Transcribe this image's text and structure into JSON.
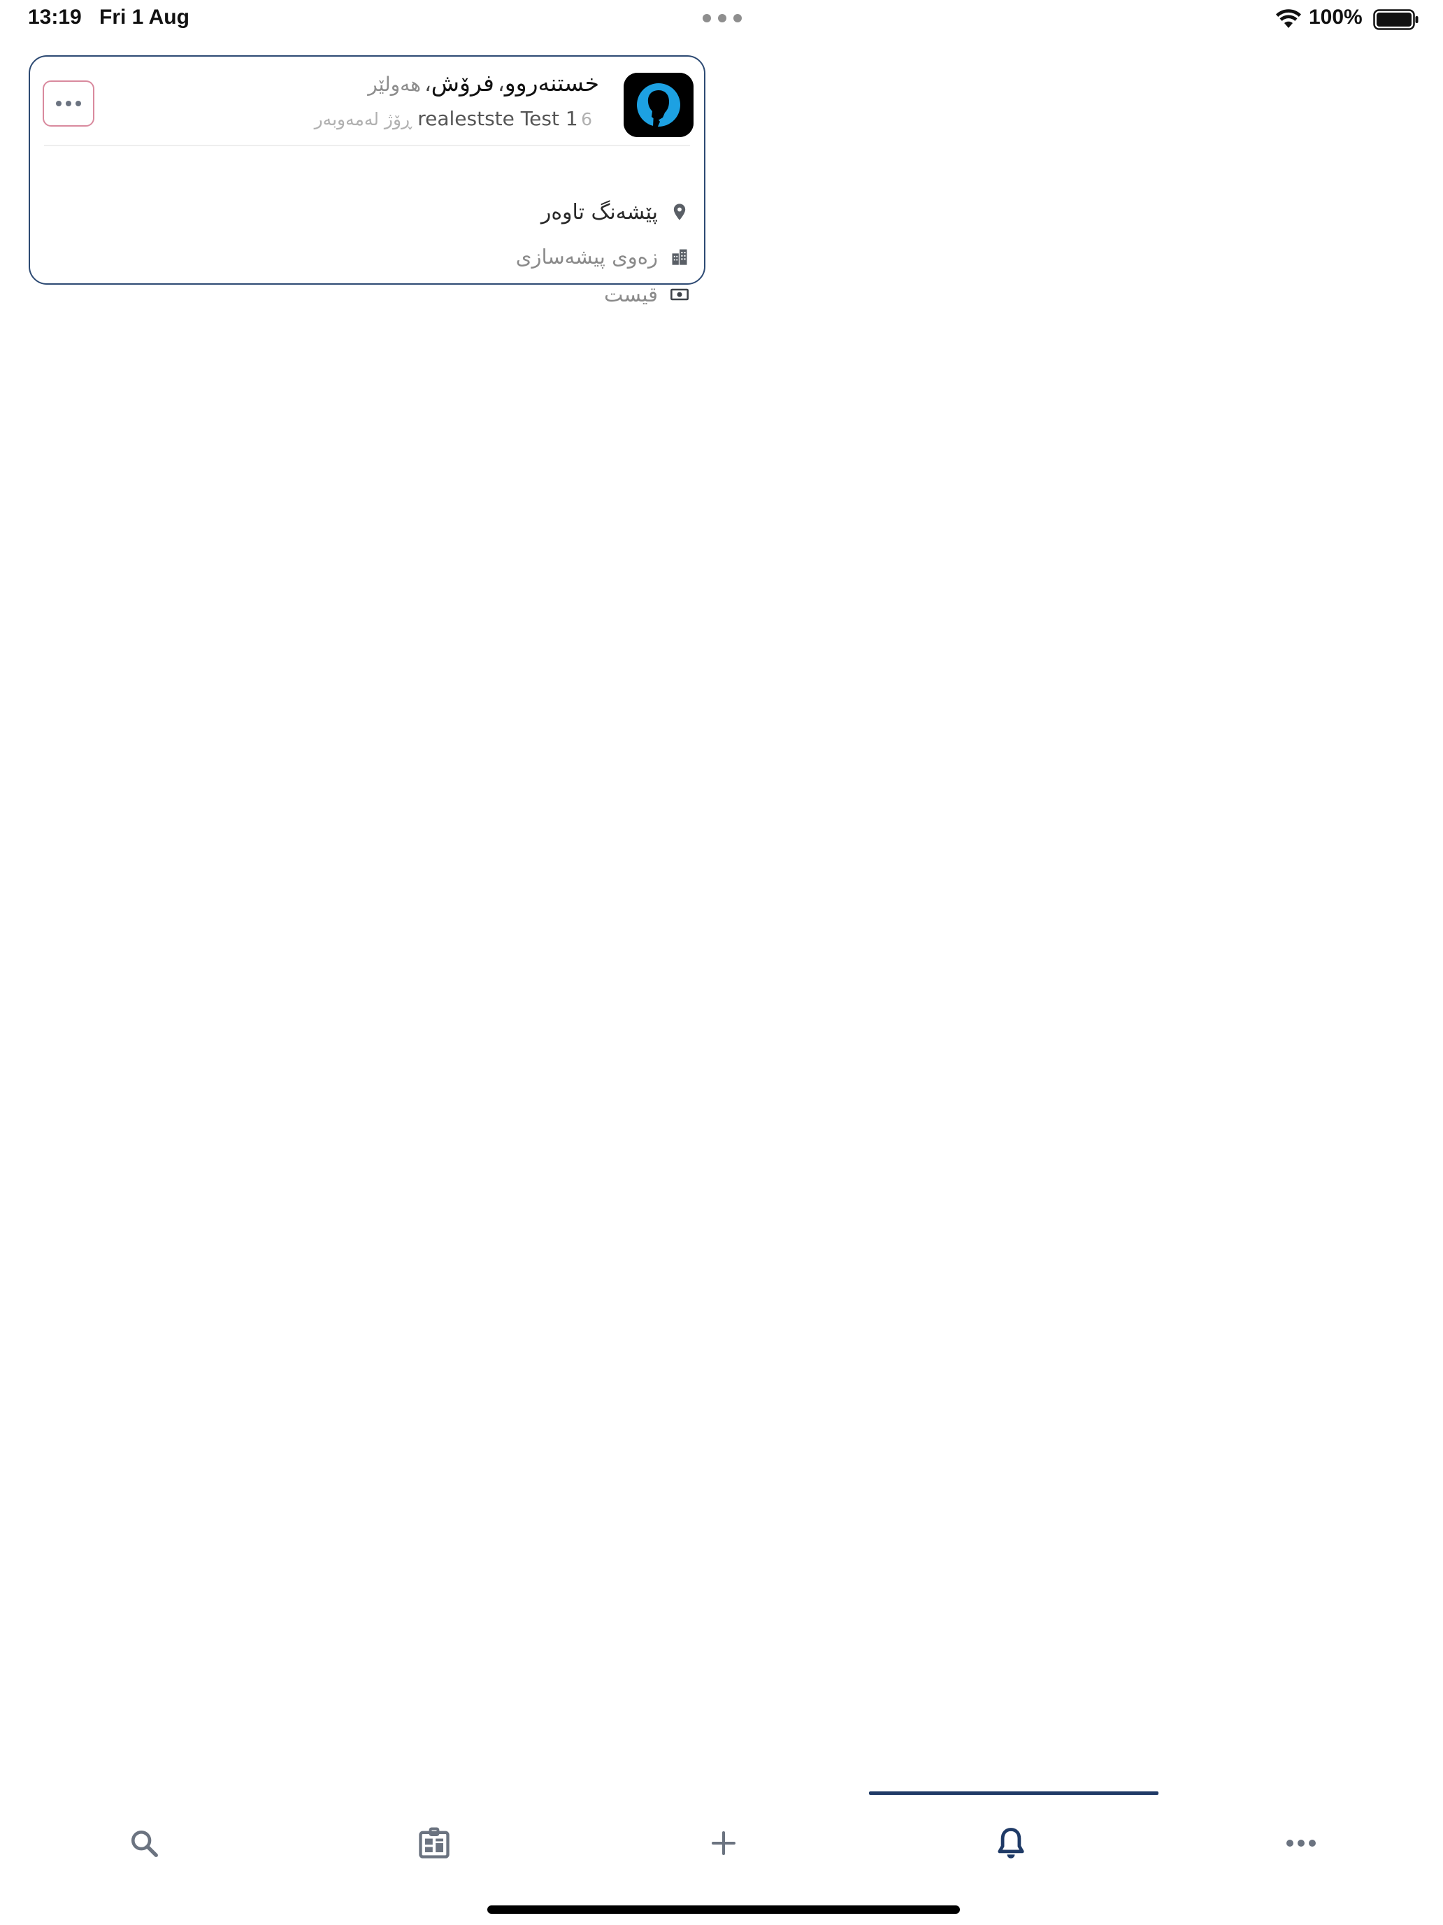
{
  "status_bar": {
    "time": "13:19",
    "date": "Fri 1 Aug",
    "battery": "100%"
  },
  "notification": {
    "title_parts": {
      "main": "خستنەروو",
      "action": "فرۆش",
      "city": "هەولێر",
      "separator": "،"
    },
    "sender": "realestste Test 1",
    "time_ago": "6 ڕۆژ لەمەوبەر",
    "location": "پێشەنگ تاوەر",
    "property_type": "زەوی پیشەسازی",
    "price": "قیست",
    "icons": {
      "location": "map-pin-icon",
      "property_type": "buildings-icon",
      "price": "banknote-icon",
      "avatar": "user-silhouette-icon",
      "more": "ellipsis-icon"
    }
  },
  "tab_bar": {
    "tabs": [
      {
        "id": "search",
        "icon": "search-icon"
      },
      {
        "id": "listings",
        "icon": "listings-icon"
      },
      {
        "id": "add",
        "icon": "plus-icon"
      },
      {
        "id": "notifications",
        "icon": "bell-icon",
        "active": true
      },
      {
        "id": "more",
        "icon": "ellipsis-icon"
      }
    ]
  },
  "colors": {
    "accent": "#1f3a66",
    "card_border": "#2d4a73",
    "more_button_border": "#d98a9e",
    "icon_gray": "#6b7380",
    "avatar_blue": "#1da1e2"
  }
}
